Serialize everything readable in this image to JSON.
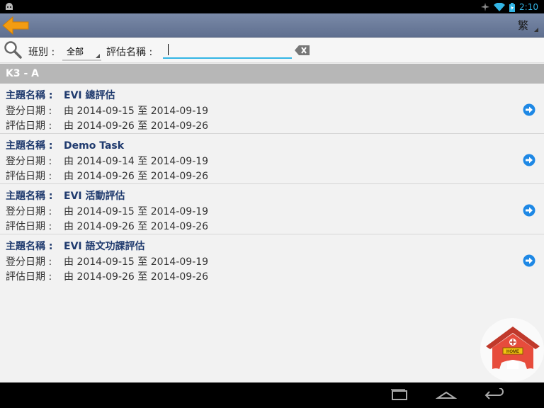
{
  "status": {
    "time": "2:10"
  },
  "actionbar": {
    "lang_label": "繁"
  },
  "filter": {
    "class_label": "班別 :",
    "class_value": "全部",
    "name_label": "評估名稱 :",
    "name_value": ""
  },
  "group": {
    "title": "K3 - A"
  },
  "items": [
    {
      "title_label": "主題名稱 :",
      "title": "EVI 總評估",
      "reg_label": "登分日期 :",
      "reg_range": "由 2014-09-15 至 2014-09-19",
      "eval_label": "評估日期 :",
      "eval_range": "由 2014-09-26 至 2014-09-26"
    },
    {
      "title_label": "主題名稱 :",
      "title": "Demo Task",
      "reg_label": "登分日期 :",
      "reg_range": "由 2014-09-14 至 2014-09-19",
      "eval_label": "評估日期 :",
      "eval_range": "由 2014-09-26 至 2014-09-26"
    },
    {
      "title_label": "主題名稱 :",
      "title": "EVI 活動評估",
      "reg_label": "登分日期 :",
      "reg_range": "由 2014-09-15 至 2014-09-19",
      "eval_label": "評估日期 :",
      "eval_range": "由 2014-09-26 至 2014-09-26"
    },
    {
      "title_label": "主題名稱 :",
      "title": "EVI 語文功課評估",
      "reg_label": "登分日期 :",
      "reg_range": "由 2014-09-15 至 2014-09-19",
      "eval_label": "評估日期 :",
      "eval_range": "由 2014-09-26 至 2014-09-26"
    }
  ],
  "home_button": {
    "label": "HOME"
  },
  "colors": {
    "accent": "#33b5e5",
    "actionbar": "#6b7b9b",
    "title_text": "#1f3a6e",
    "arrow": "#1e88e5",
    "back_arrow": "#f39c12"
  }
}
